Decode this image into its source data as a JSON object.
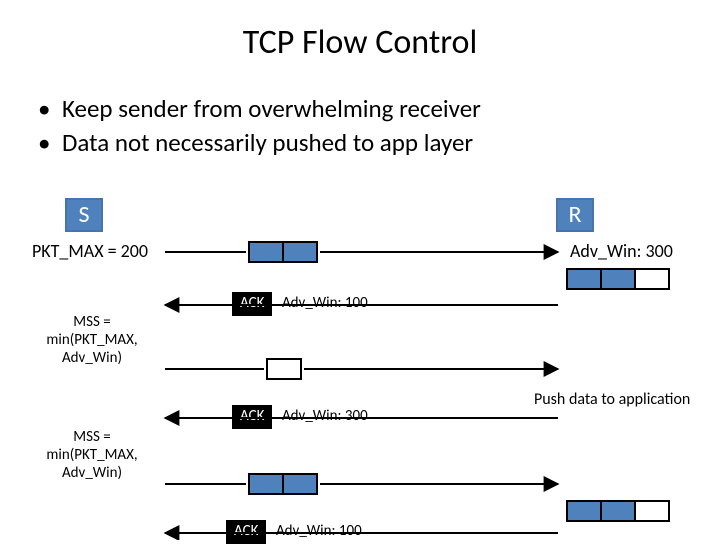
{
  "title": "TCP Flow Control",
  "bullets": {
    "b1": "Keep sender from overwhelming receiver",
    "b2": "Data not necessarily pushed to app layer"
  },
  "sender": {
    "label": "S",
    "pkt_max": "PKT_MAX = 200"
  },
  "receiver": {
    "label": "R",
    "adv_win": "Adv_Win: 300",
    "push_text": "Push data to application"
  },
  "mss1": "MSS = min(PKT_MAX, Adv_Win)",
  "mss2": "MSS = min(PKT_MAX, Adv_Win)",
  "ack1": {
    "tag": "ACK",
    "text": "Adv_Win: 100"
  },
  "ack2": {
    "tag": "ACK",
    "text": "Adv_Win: 300"
  },
  "ack3": {
    "tag": "ACK",
    "text": "Adv_Win: 100"
  },
  "buffers": {
    "send1": [
      true,
      true
    ],
    "recv1": [
      true,
      true,
      false
    ],
    "empty_mid": [
      false
    ],
    "send2": [
      true,
      true
    ],
    "recv2": [
      true,
      true,
      false
    ]
  }
}
